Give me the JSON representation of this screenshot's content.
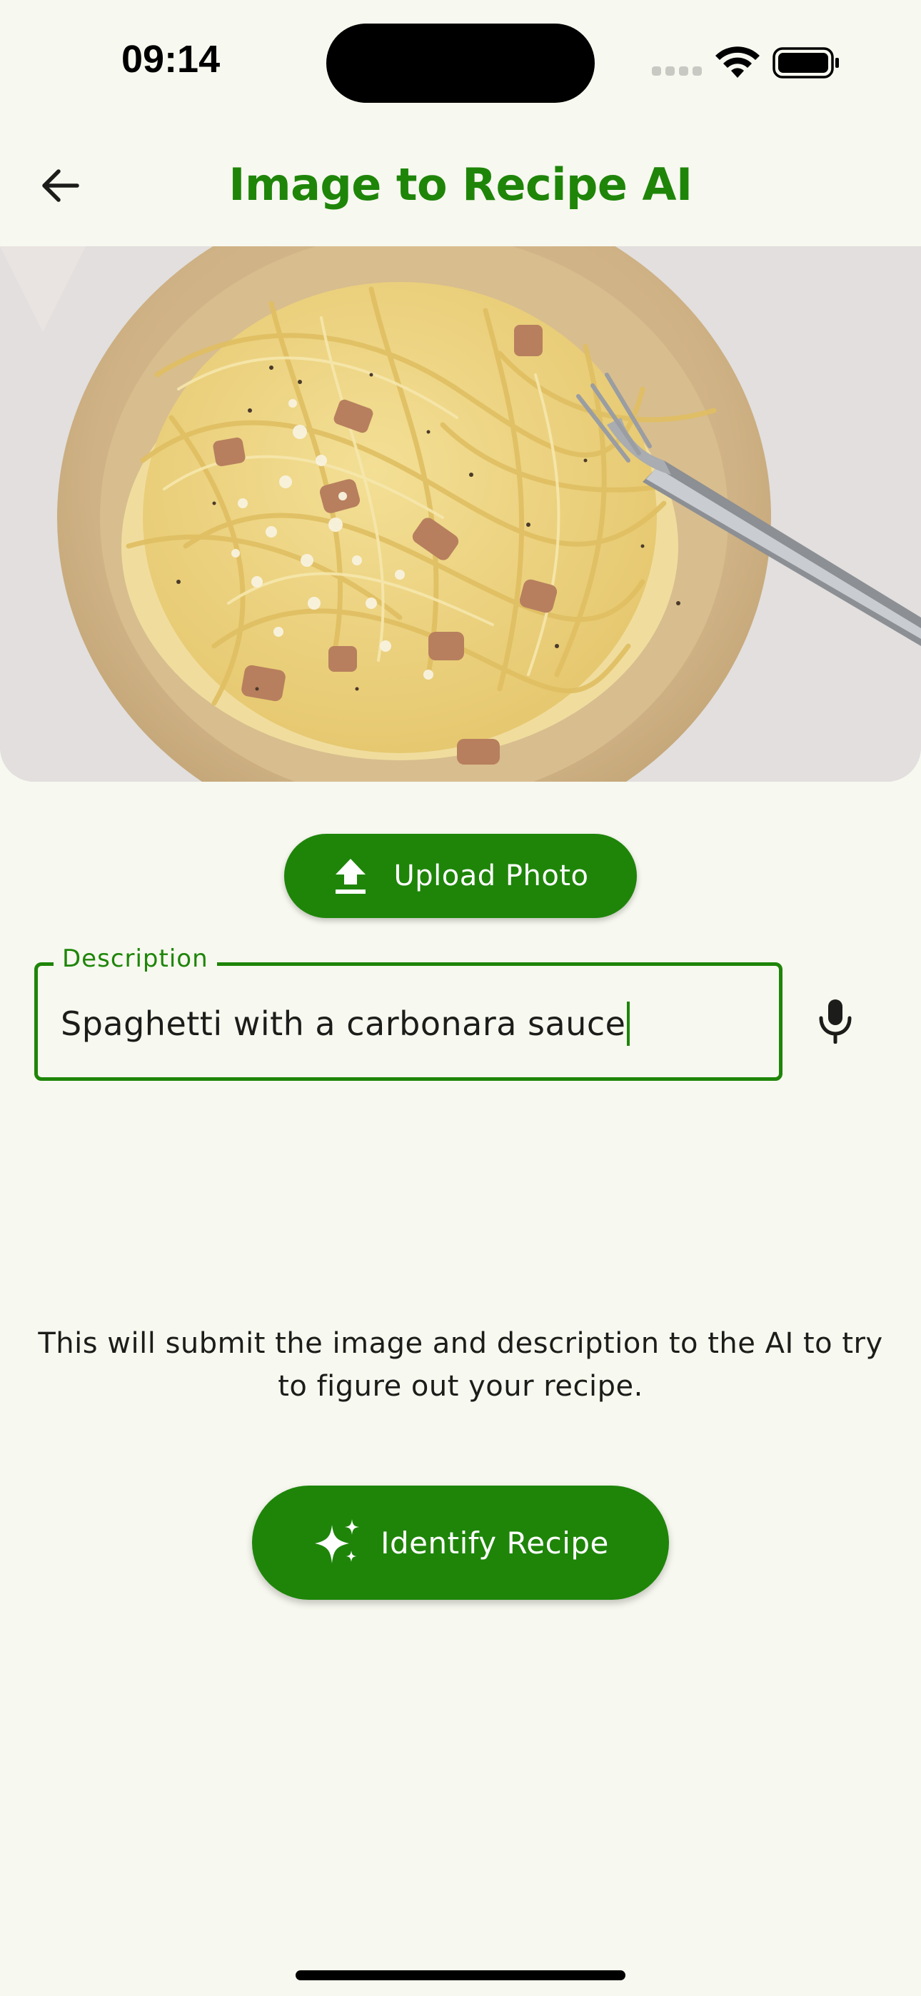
{
  "status_bar": {
    "time": "09:14",
    "icons": [
      "cellular-signal-icon",
      "wifi-icon",
      "battery-icon"
    ]
  },
  "app_bar": {
    "back_icon": "arrow-left-icon",
    "title": "Image to Recipe AI"
  },
  "hero_image": {
    "subject": "plate-of-spaghetti-carbonara-photo"
  },
  "upload": {
    "icon": "upload-icon",
    "label": "Upload Photo"
  },
  "description": {
    "label": "Description",
    "value": "Spaghetti with a carbonara sauce",
    "mic_icon": "microphone-icon"
  },
  "info": {
    "text": "This will submit the image and description to the AI to try to figure out your recipe."
  },
  "identify": {
    "icon": "sparkles-icon",
    "label": "Identify Recipe"
  },
  "colors": {
    "accent": "#1e8509",
    "background": "#f7f8ef",
    "text": "#1c1c1a"
  }
}
